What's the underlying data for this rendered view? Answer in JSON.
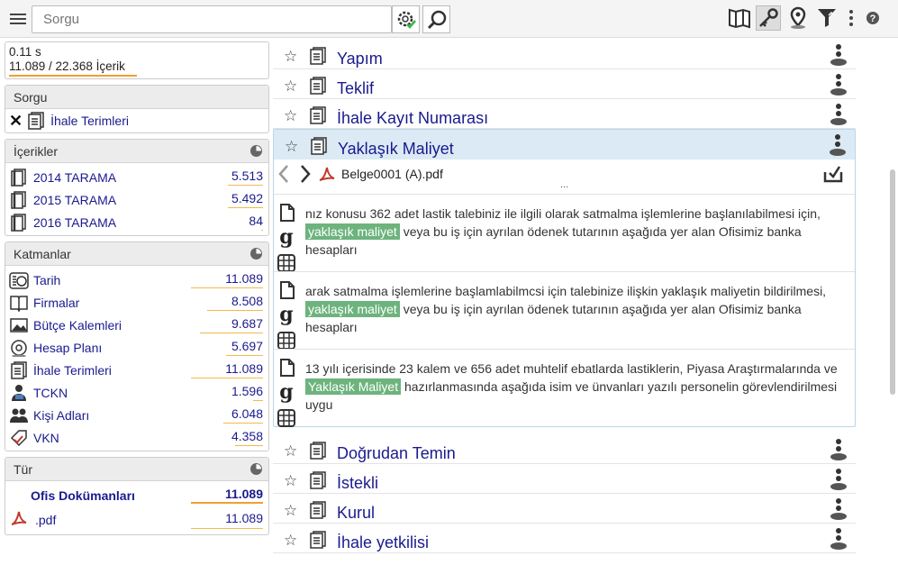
{
  "topbar": {
    "search_placeholder": "Sorgu"
  },
  "stats": {
    "time": "0.11 s",
    "count": "11.089 / 22.368 İçerik"
  },
  "query": {
    "title": "Sorgu",
    "term": "İhale Terimleri"
  },
  "contents": {
    "title": "İçerikler",
    "items": [
      {
        "label": "2014 TARAMA",
        "value": "5.513",
        "fill": 0.49
      },
      {
        "label": "2015 TARAMA",
        "value": "5.492",
        "fill": 0.49
      },
      {
        "label": "2016 TARAMA",
        "value": "84",
        "fill": 0.02
      }
    ]
  },
  "layers": {
    "title": "Katmanlar",
    "items": [
      {
        "label": "Tarih",
        "value": "11.089",
        "fill": 1.0,
        "icon": "calendar-icon"
      },
      {
        "label": "Firmalar",
        "value": "8.508",
        "fill": 0.77,
        "icon": "book-icon"
      },
      {
        "label": "Bütçe Kalemleri",
        "value": "9.687",
        "fill": 0.87,
        "icon": "image-icon"
      },
      {
        "label": "Hesap Planı",
        "value": "5.697",
        "fill": 0.51,
        "icon": "at-icon"
      },
      {
        "label": "İhale Terimleri",
        "value": "11.089",
        "fill": 1.0,
        "icon": "document-icon"
      },
      {
        "label": "TCKN",
        "value": "1.596",
        "fill": 0.14,
        "icon": "person-id-icon"
      },
      {
        "label": "Kişi Adları",
        "value": "6.048",
        "fill": 0.55,
        "icon": "people-icon"
      },
      {
        "label": "VKN",
        "value": "4.358",
        "fill": 0.39,
        "icon": "tag-icon"
      }
    ]
  },
  "type": {
    "title": "Tür",
    "items": [
      {
        "label": "Ofis Dokümanları",
        "value": "11.089",
        "fill": 1.0
      },
      {
        "label": ".pdf",
        "value": "11.089",
        "fill": 1.0
      }
    ]
  },
  "results_top": [
    "Yapım",
    "Teklif",
    "İhale Kayıt Numarası"
  ],
  "expanded": {
    "title": "Yaklaşık Maliyet",
    "file": "Belge0001 (A).pdf",
    "more": "...",
    "snippets": [
      {
        "pre": "nız konusu 362 adet lastik talebiniz ile ilgili olarak satmalma işlemlerine başlanılabilmesi için, ",
        "hl": "yaklaşık maliyet",
        "post": " veya bu iş için ayrılan ödenek tutarının aşağıda yer alan Ofisimiz banka hesapları"
      },
      {
        "pre": "arak satmalma işlemlerine başlamlabilmcsi için talebinize ilişkin yaklaşık maliyetin bildirilmesi, ",
        "hl": "yaklaşık maliyet",
        "post": " veya bu iş için ayrılan ödenek tutarının aşağıda yer alan Ofisimiz banka hesapları"
      },
      {
        "pre": "13 yılı içerisinde 23 kalem ve 656 adet muhtelif ebatlarda lastiklerin, Piyasa Araştırmalarında ve ",
        "hl": "Yaklaşık Maliyet",
        "post": " hazırlanmasında aşağıda isim ve ünvanları yazılı personelin görevlendirilmesi uygu"
      }
    ]
  },
  "results_bottom": [
    "Doğrudan Temin",
    "İstekli",
    "Kurul",
    "İhale yetkilisi"
  ],
  "colors": {
    "link": "#1a1a8e",
    "highlight": "#6db37d",
    "bar": "#f0a030",
    "expanded_bg": "#dbeaf5"
  }
}
